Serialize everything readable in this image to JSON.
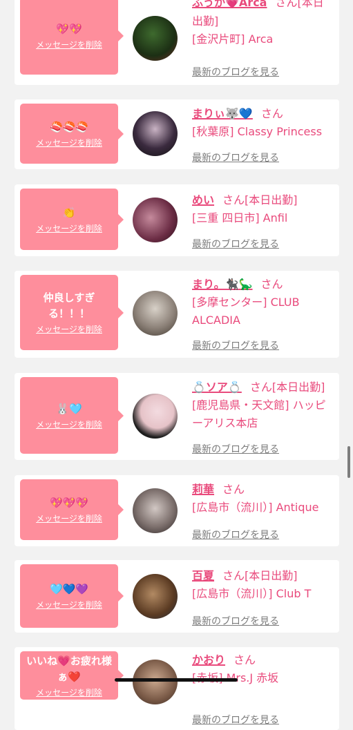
{
  "delete_label": "メッセージを削除",
  "blog_label": "最新のブログを見る",
  "san": "さん",
  "colors": {
    "accent": "#e94a7c",
    "bubble": "#fe8e9c",
    "link_gray": "#7c7c7c"
  },
  "items": [
    {
      "message": "💖💖",
      "name": "ふうか💗Arca",
      "status": "[本日出勤]",
      "shop": "[金沢片町] Arca"
    },
    {
      "message": "🍣🍣🍣",
      "name": "まりぃ🐺💙",
      "status": "",
      "shop": "[秋葉原] Classy Princess"
    },
    {
      "message": "👏",
      "name": "めい",
      "status": "[本日出勤]",
      "shop": "[三重 四日市] Anfil"
    },
    {
      "message": "仲良しすぎる！！！",
      "name": "まり。🐈‍⬛🦕",
      "status": "",
      "shop": "[多摩センター] CLUB ALCADIA"
    },
    {
      "message": "🐰🩵",
      "name": "💍ソア💍",
      "status": "[本日出勤]",
      "shop": "[鹿児島県・天文館] ハッピーアリス本店"
    },
    {
      "message": "💖💖💖",
      "name": "莉華",
      "status": "",
      "shop": "[広島市（流川）] Antique"
    },
    {
      "message": "🩵💙💜",
      "name": "百夏",
      "status": "[本日出勤]",
      "shop": "[広島市（流川）] Club T"
    },
    {
      "message": "いいね💗お疲れ様ぁ❤️",
      "name": "かおり",
      "status": "",
      "shop": "[赤坂] Mrs.J 赤坂"
    }
  ]
}
